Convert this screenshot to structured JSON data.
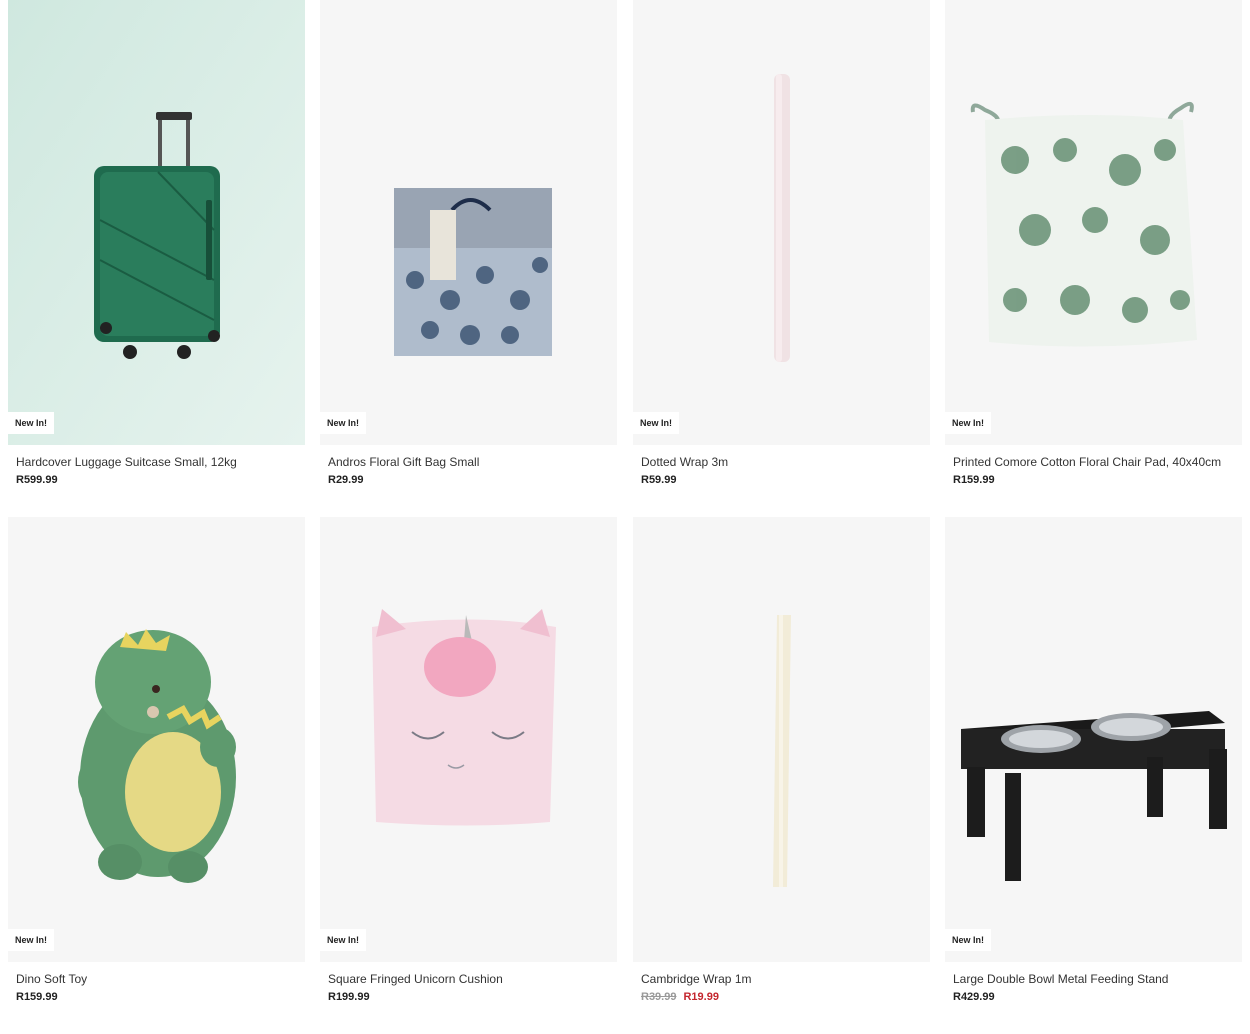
{
  "products": [
    {
      "name": "Hardcover Luggage Suitcase Small, 12kg",
      "price": "R599.99",
      "badge": "New In!",
      "image": "green-suitcase"
    },
    {
      "name": "Andros Floral Gift Bag Small",
      "price": "R29.99",
      "badge": "New In!",
      "image": "floral-gift-bag"
    },
    {
      "name": "Dotted Wrap 3m",
      "price": "R59.99",
      "badge": "New In!",
      "image": "pink-wrap-roll"
    },
    {
      "name": "Printed Comore Cotton Floral Chair Pad, 40x40cm",
      "price": "R159.99",
      "badge": "New In!",
      "image": "floral-chair-pad"
    },
    {
      "name": "Dino Soft Toy",
      "price": "R159.99",
      "badge": "New In!",
      "image": "green-dino-plush"
    },
    {
      "name": "Square Fringed Unicorn Cushion",
      "price": "R199.99",
      "badge": "New In!",
      "image": "pink-unicorn-cushion"
    },
    {
      "name": "Cambridge Wrap 1m",
      "was_price": "R39.99",
      "sale_price": "R19.99",
      "image": "cream-wrap-roll"
    },
    {
      "name": "Large Double Bowl Metal Feeding Stand",
      "price": "R429.99",
      "badge": "New In!",
      "image": "pet-feeding-stand"
    }
  ],
  "colors": {
    "sale": "#c4262e",
    "image_bg": "#f6f6f6",
    "suitcase_bg": "#d8ece4"
  }
}
